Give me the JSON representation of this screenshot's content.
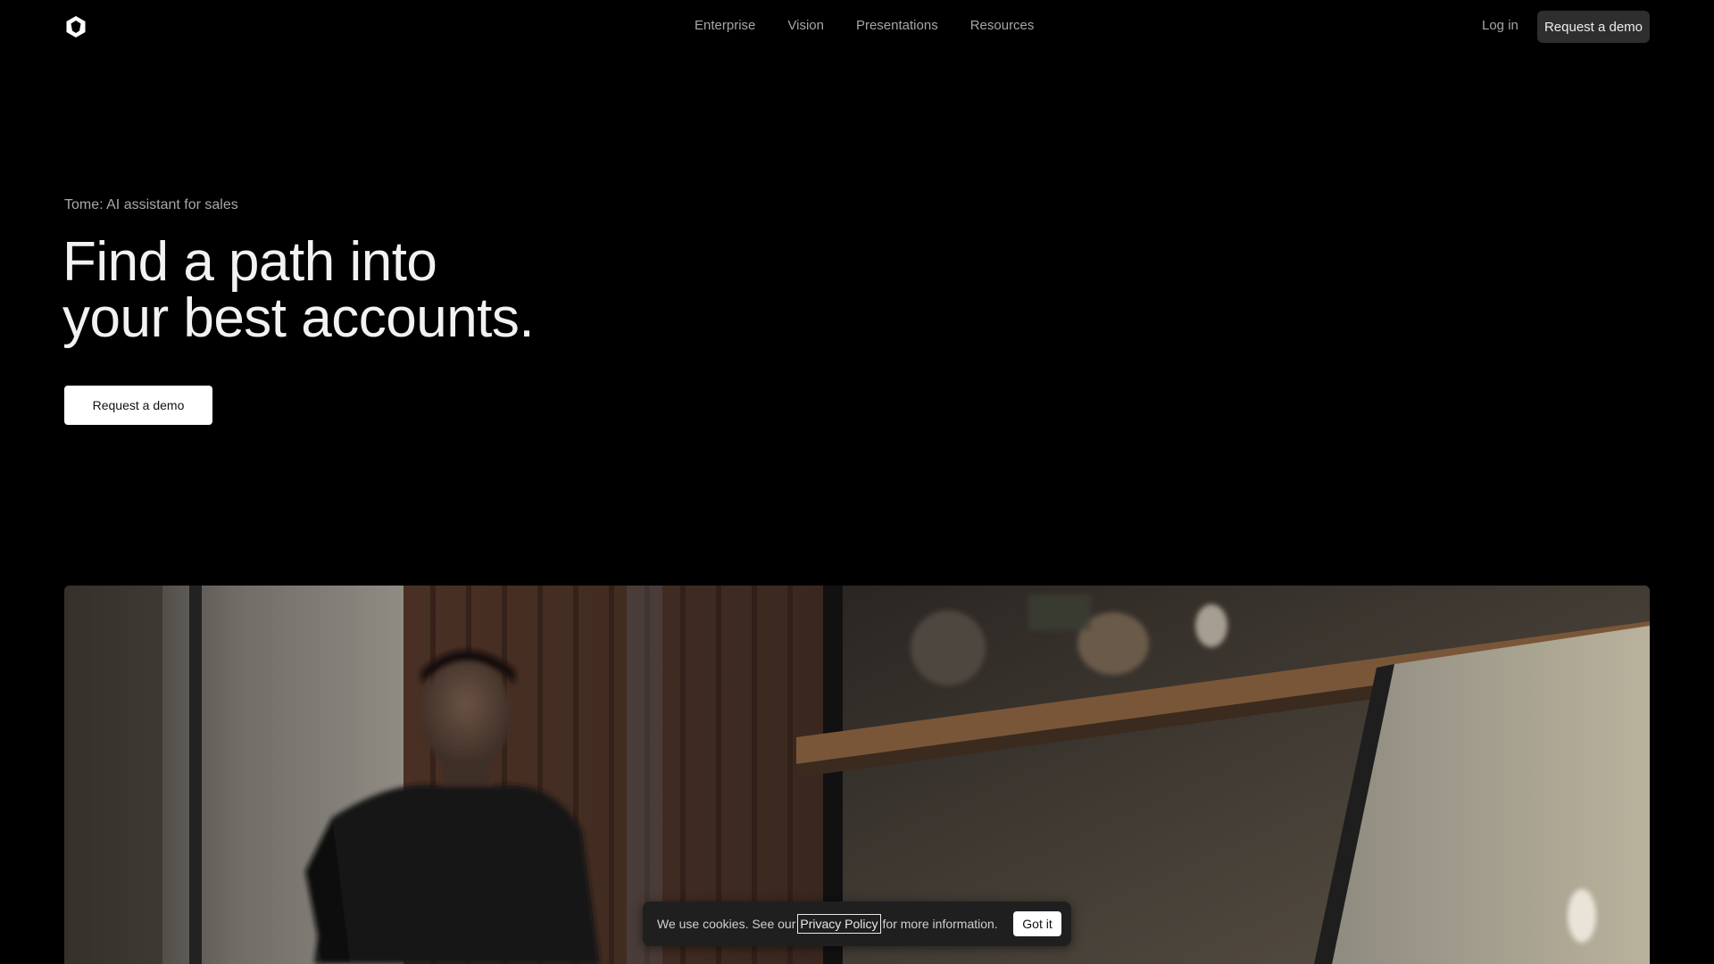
{
  "header": {
    "logo": "tome-logo-icon",
    "nav": [
      "Enterprise",
      "Vision",
      "Presentations",
      "Resources"
    ],
    "login_label": "Log in",
    "demo_label": "Request a demo"
  },
  "hero": {
    "eyebrow": "Tome: AI assistant for sales",
    "headline_line1": "Find a path into",
    "headline_line2": "your best accounts.",
    "cta_label": "Request a demo"
  },
  "media": {
    "description_icon": "video-still"
  },
  "cookie_banner": {
    "text_before": "We use cookies. See our",
    "link_label": "Privacy Policy",
    "text_after": "for more information.",
    "button_label": "Got it"
  },
  "colors": {
    "background": "#000000",
    "nav_text": "#a6a6a6",
    "top_button_bg": "#2e2e2e",
    "hero_button_bg": "#ffffff"
  }
}
